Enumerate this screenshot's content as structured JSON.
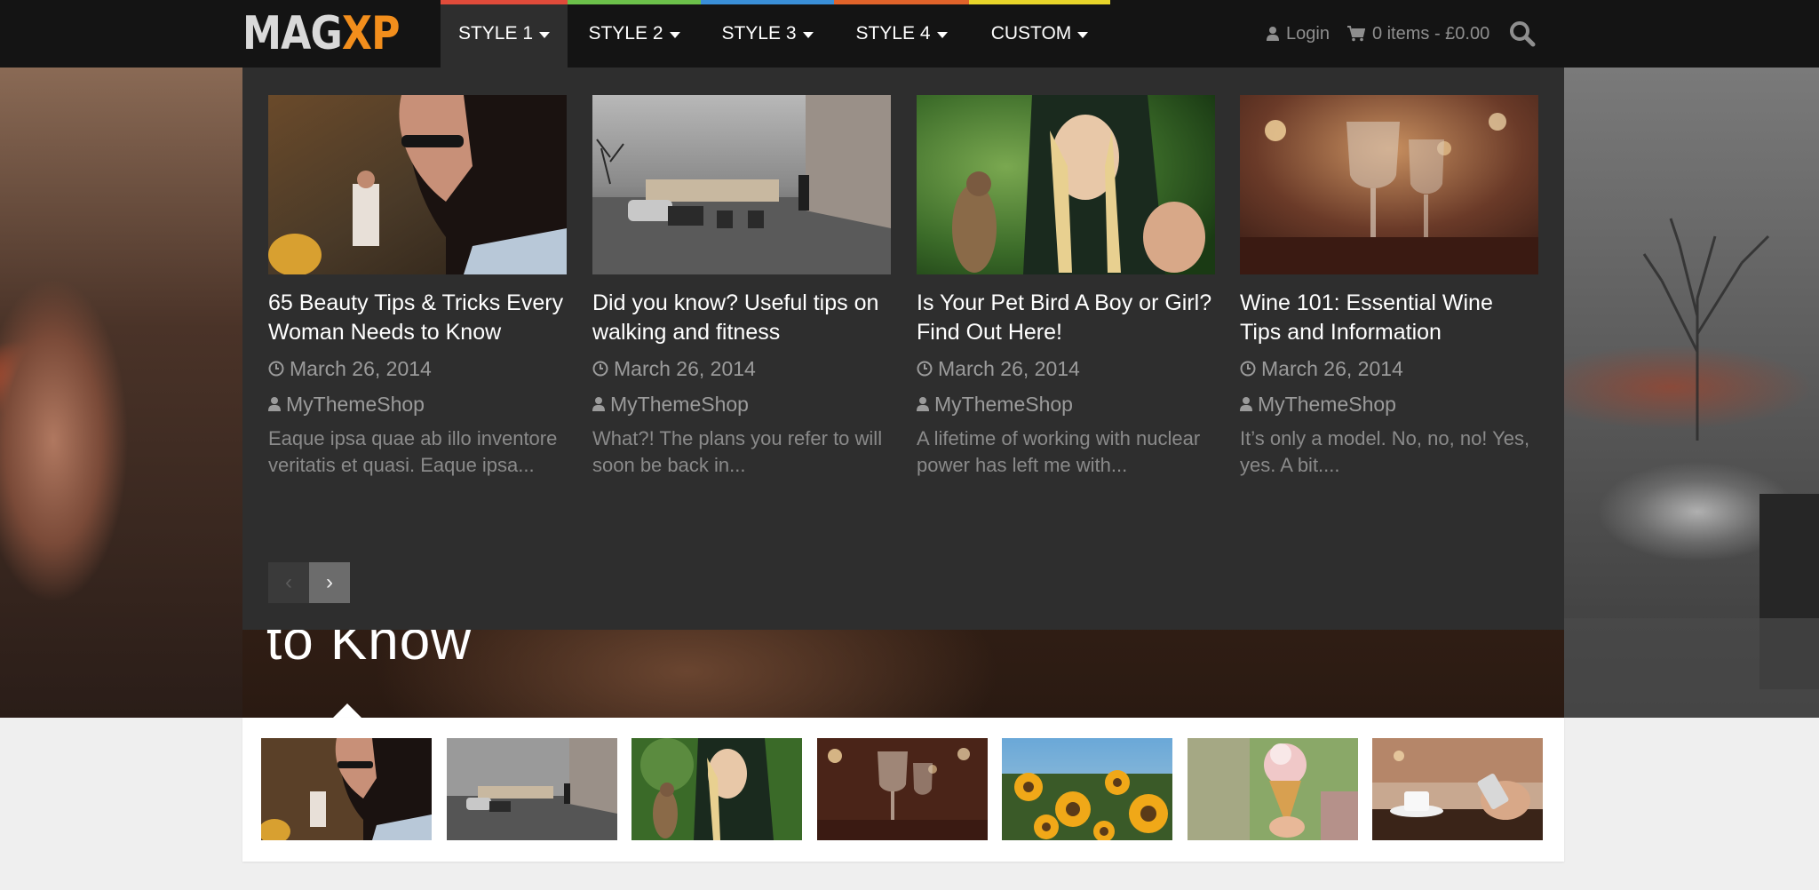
{
  "logo": {
    "part1": "MAG",
    "part2": "XP"
  },
  "nav": {
    "items": [
      {
        "label": "STYLE 1",
        "accent": "#e04b3a",
        "active": true
      },
      {
        "label": "STYLE 2",
        "accent": "#6cc04a",
        "active": false
      },
      {
        "label": "STYLE 3",
        "accent": "#3a8fd8",
        "active": false
      },
      {
        "label": "STYLE 4",
        "accent": "#e0632a",
        "active": false
      },
      {
        "label": "CUSTOM",
        "accent": "#e8d52a",
        "active": false
      }
    ]
  },
  "header": {
    "login_label": "Login",
    "cart_label": "0 items - £0.00",
    "icons": [
      "user-icon",
      "cart-icon",
      "search-icon"
    ]
  },
  "hero": {
    "title_fragment": "to Know"
  },
  "dropdown": {
    "posts": [
      {
        "title": "65 Beauty Tips & Tricks Every Woman Needs to Know",
        "date": "March 26, 2014",
        "author": "MyThemeShop",
        "excerpt": "Eaque ipsa quae ab illo inventore veritatis et quasi. Eaque ipsa..."
      },
      {
        "title": "Did you know? Useful tips on walking and fitness",
        "date": "March 26, 2014",
        "author": "MyThemeShop",
        "excerpt": "What?! The plans you refer to will soon be back in..."
      },
      {
        "title": "Is Your Pet Bird A Boy or Girl? Find Out Here!",
        "date": "March 26, 2014",
        "author": "MyThemeShop",
        "excerpt": "A lifetime of working with nuclear power has left me with..."
      },
      {
        "title": "Wine 101: Essential Wine Tips and Information",
        "date": "March 26, 2014",
        "author": "MyThemeShop",
        "excerpt": "It’s only a model. No, no, no! Yes, yes. A bit...."
      }
    ],
    "prev_label": "‹",
    "next_label": "›"
  }
}
